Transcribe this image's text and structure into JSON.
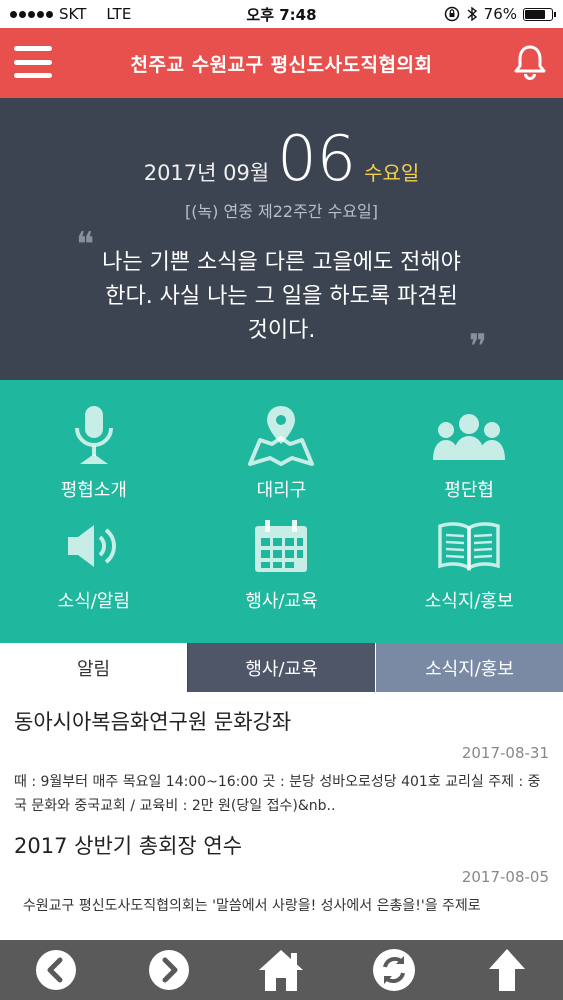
{
  "status": {
    "carrier": "SKT",
    "network": "LTE",
    "time": "오후 7:48",
    "battery": "76%",
    "battery_level": 0.76
  },
  "header": {
    "title": "천주교 수원교구 평신도사도직협의회",
    "menu_icon": "hamburger-menu-icon",
    "bell_icon": "bell-icon"
  },
  "daily": {
    "year_month": "2017년 09월",
    "day": "06",
    "weekday": "수요일",
    "liturgy": "[(녹) 연중 제22주간 수요일]",
    "quote_open": "❝",
    "quote_close": "❞",
    "quote": "나는 기쁜 소식을 다른 고을에도 전해야 한다. 사실 나는 그 일을 하도록 파견된 것이다."
  },
  "menu": [
    {
      "label": "평협소개",
      "icon": "microphone-icon"
    },
    {
      "label": "대리구",
      "icon": "map-pin-icon"
    },
    {
      "label": "평단협",
      "icon": "group-icon"
    },
    {
      "label": "소식/알림",
      "icon": "speaker-icon"
    },
    {
      "label": "행사/교육",
      "icon": "calendar-icon"
    },
    {
      "label": "소식지/홍보",
      "icon": "book-icon"
    }
  ],
  "tabs": [
    {
      "label": "알림"
    },
    {
      "label": "행사/교육"
    },
    {
      "label": "소식지/홍보"
    }
  ],
  "news": [
    {
      "title": "동아시아복음화연구원 문화강좌",
      "date": "2017-08-31",
      "body": "때 : 9월부터 매주 목요일 14:00~16:00 곳 : 분당 성바오로성당 401호 교리실 주제 : 중국 문화와 중국교회 / 교육비 : 2만 원(당일 접수)&nb.."
    },
    {
      "title": "2017 상반기 총회장 연수",
      "date": "2017-08-05",
      "body": "  수원교구 평신도사도직협의회는 '말씀에서 사랑을! 성사에서 은총을!'을 주제로"
    }
  ],
  "bottom_nav": [
    {
      "icon": "back-arrow-icon"
    },
    {
      "icon": "forward-arrow-icon"
    },
    {
      "icon": "home-icon"
    },
    {
      "icon": "refresh-icon"
    },
    {
      "icon": "scroll-top-icon"
    }
  ],
  "colors": {
    "header": "#e8504d",
    "daily_bg": "#3d4451",
    "grid_bg": "#1fb79d",
    "weekday": "#f2d04a",
    "tab_inactive": "#4e5668",
    "tab_last": "#7a8aa5",
    "bottom_bar": "#5a5a5a"
  }
}
